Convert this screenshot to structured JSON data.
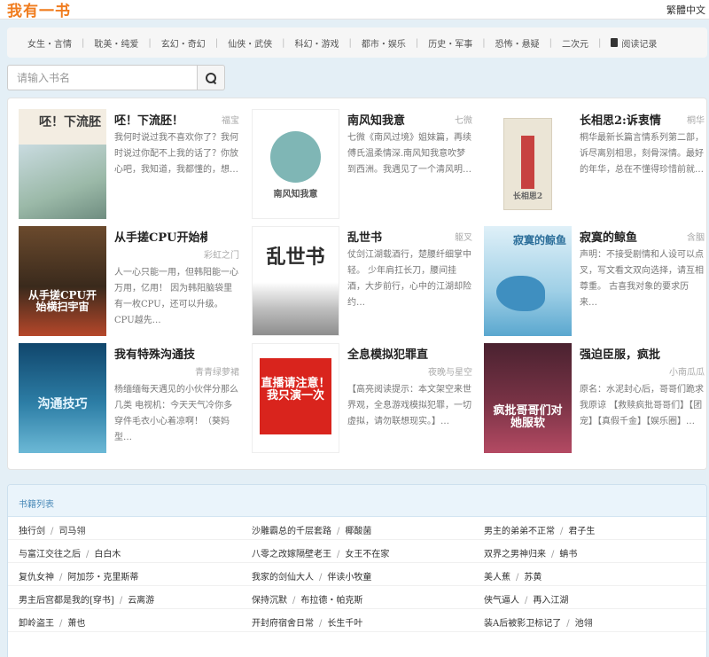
{
  "site": {
    "logo": "我有一书",
    "lang_switch": "繁體中文"
  },
  "nav": {
    "items": [
      "女生・言情",
      "耽美・纯爱",
      "玄幻・奇幻",
      "仙侠・武侠",
      "科幻・游戏",
      "都市・娱乐",
      "历史・军事",
      "恐怖・悬疑",
      "二次元"
    ],
    "history_label": "阅读记录"
  },
  "search": {
    "placeholder": "请输入书名",
    "value": ""
  },
  "featured": [
    {
      "title": "呸！下流胚！",
      "author": "福宝",
      "desc": "我何时说过我不喜欢你了？我何时说过你配不上我的话了？你放心吧，我知道，我都懂的，想…",
      "cover_text": "呸！下流胚",
      "cover_colors": [
        "#f3ede2",
        "#9bb9a8"
      ]
    },
    {
      "title": "南风知我意",
      "author": "七微",
      "desc": "七微《南风过境》姐妹篇，再续傅氏温柔情深.南风知我意吹梦到西洲。我遇见了一个清风明…",
      "cover_text": "南风知我意",
      "cover_colors": [
        "#ffffff",
        "#7fb6b5"
      ]
    },
    {
      "title": "长相思2:诉衷情",
      "author": "桐华",
      "desc": "桐华最新长篇言情系列第二部，诉尽离别相思，刻骨深情。最好的年华，总在不懂得珍惜前就…",
      "cover_text": "长相思2",
      "cover_colors": [
        "#ffffff",
        "#c74240"
      ]
    },
    {
      "title": "从手搓CPU开始横",
      "author": "彩虹之门",
      "desc": "人一心只能一用，但韩阳能一心万用，亿用！ 因为韩阳脑袋里有一枚CPU，还可以升级。CPU越先…",
      "cover_text": "从手搓CPU开始横扫宇宙",
      "cover_colors": [
        "#6b4a2d",
        "#b6472a"
      ]
    },
    {
      "title": "乱世书",
      "author": "躯叉",
      "desc": "仗剑江湖载酒行，楚腰纤细掌中轻。 少年肩扛长刀，腰间挂酒，大步前行，心中的江湖却险约…",
      "cover_text": "乱世书",
      "cover_colors": [
        "#ffffff",
        "#8a8a8a"
      ]
    },
    {
      "title": "寂寞的鲸鱼",
      "author": "含胭",
      "desc": "声明：不接受剧情和人设可以点叉，写文看文双向选择，请互相尊重。 古喜我对象的要求历来…",
      "cover_text": "寂寞的鲸鱼",
      "cover_colors": [
        "#dff0f8",
        "#5aa7cf"
      ]
    },
    {
      "title": "我有特殊沟通技",
      "author": "青青绿萝裙",
      "desc": "杨缅缅每天遇见的小伙伴分那么几类 电视机：今天天气冷你多穿件毛衣小心着凉啊！（葵妈型…",
      "cover_text": "沟通技巧",
      "cover_colors": [
        "#10466c",
        "#6cb9d6"
      ]
    },
    {
      "title": "全息模拟犯罪直",
      "author": "夜晚与星空",
      "desc": "【高亮阅读提示：本文架空来世界观，全息游戏模拟犯罪，一切虚拟，请勿联想现实。】…",
      "cover_text": "直播请注意！我只演一次",
      "cover_colors": [
        "#ffffff",
        "#d9241d"
      ]
    },
    {
      "title": "强迫臣服，疯批",
      "author": "小南瓜瓜",
      "desc": "原名：水泥封心后，哥哥们跪求我原谅 【救赎疯批哥哥们】【团宠】【真假千金】【娱乐圈】…",
      "cover_text": "疯批哥哥们对她服软",
      "cover_colors": [
        "#4a2230",
        "#b44a63"
      ]
    }
  ],
  "book_list": {
    "header": "书籍列表",
    "rows": [
      [
        {
          "title": "独行剑",
          "author": "司马翎"
        },
        {
          "title": "沙雕霸总的千层套路",
          "author": "椰酸菌"
        },
        {
          "title": "男主的弟弟不正常",
          "author": "君子生"
        }
      ],
      [
        {
          "title": "与富江交往之后",
          "author": "白白木"
        },
        {
          "title": "八零之改嫁隔壁老王",
          "author": "女王不在家"
        },
        {
          "title": "双界之男神归来",
          "author": "蚺书"
        }
      ],
      [
        {
          "title": "复仇女神",
          "author": "阿加莎・克里斯蒂"
        },
        {
          "title": "我家的剑仙大人",
          "author": "伴读小牧童"
        },
        {
          "title": "美人蕉",
          "author": "苏黄"
        }
      ],
      [
        {
          "title": "男主后宫都是我的[穿书]",
          "author": "云离游"
        },
        {
          "title": "保持沉默",
          "author": "布拉德・帕克斯"
        },
        {
          "title": "侠气逼人",
          "author": "再入江湖"
        }
      ],
      [
        {
          "title": "卸岭盗王",
          "author": "萧也"
        },
        {
          "title": "开封府宿舍日常",
          "author": "长生千叶"
        },
        {
          "title": "装A后被影卫标记了",
          "author": "池翎"
        }
      ]
    ]
  }
}
